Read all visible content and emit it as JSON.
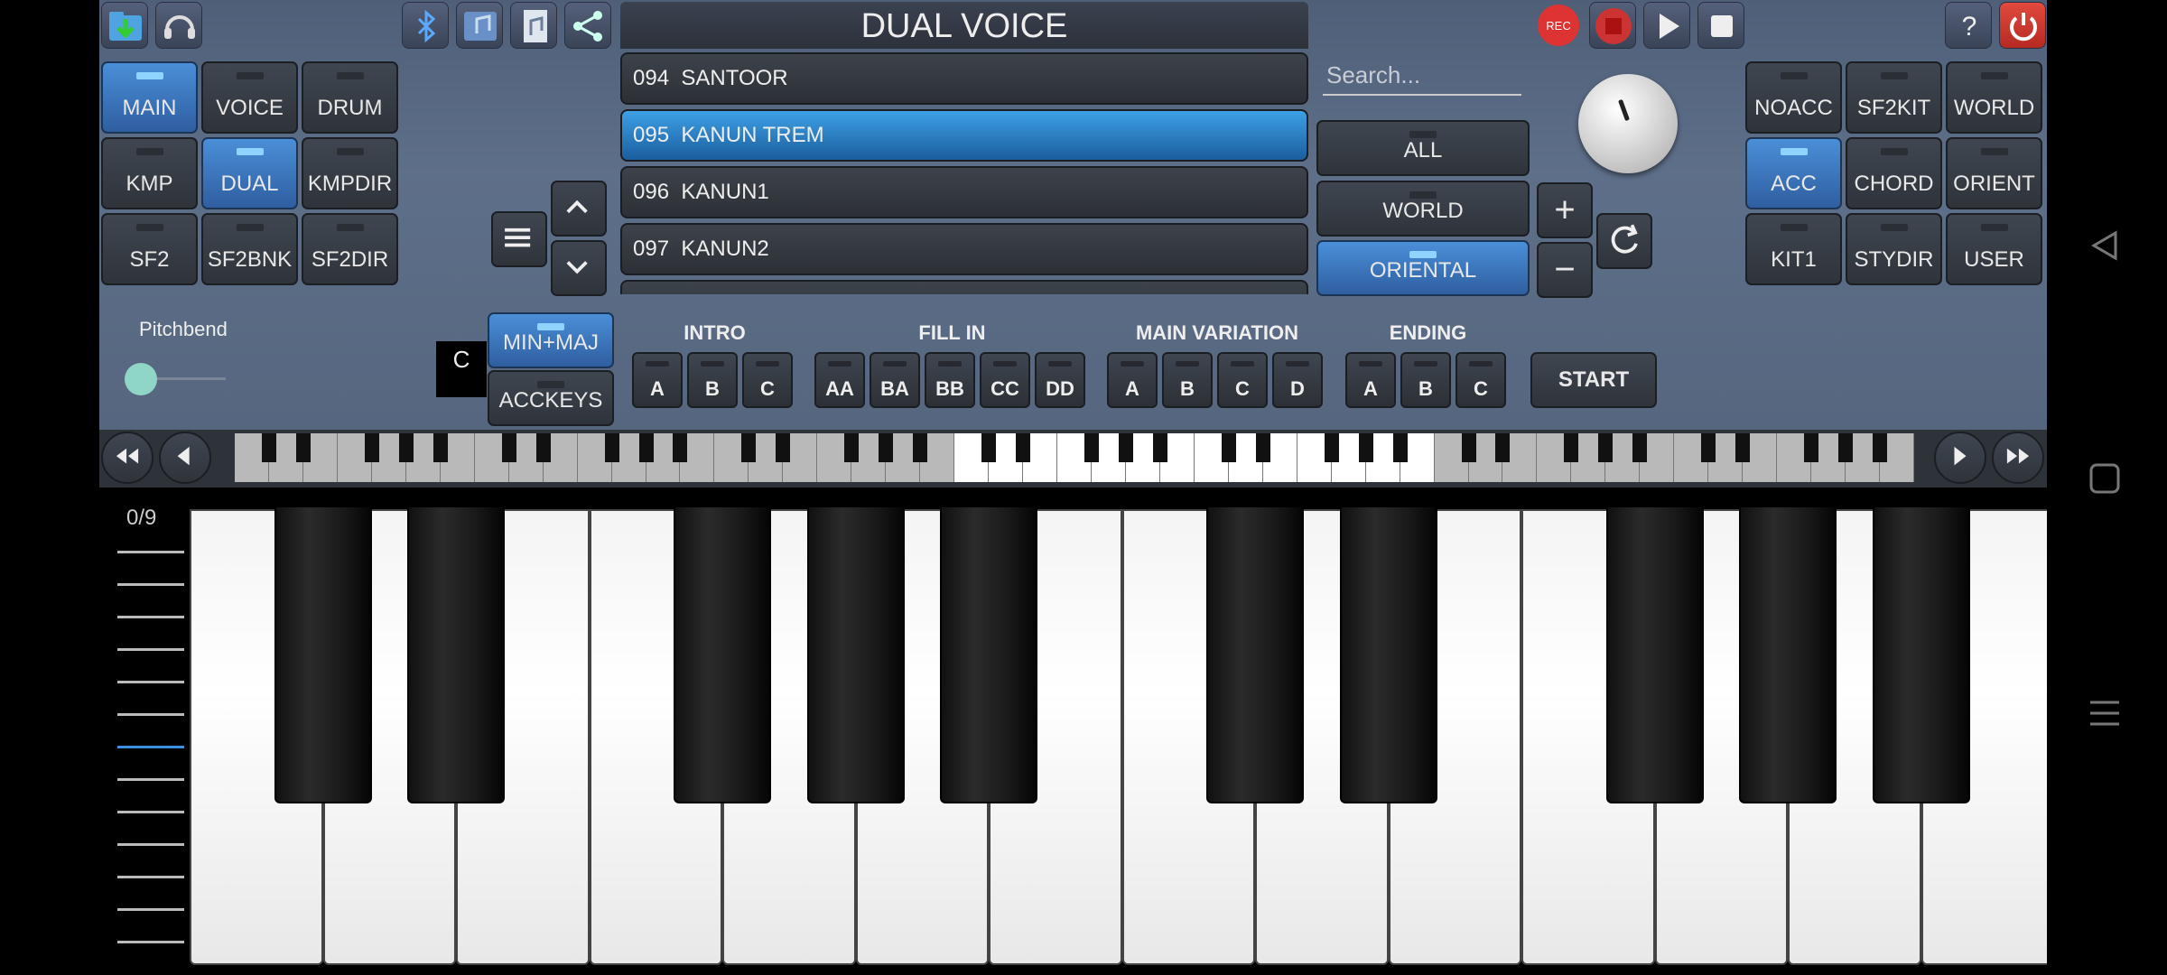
{
  "title": "DUAL VOICE",
  "search": {
    "placeholder": "Search..."
  },
  "mode_buttons": [
    {
      "label": "MAIN",
      "on": true
    },
    {
      "label": "VOICE",
      "on": false
    },
    {
      "label": "DRUM",
      "on": false
    },
    {
      "label": "KMP",
      "on": false
    },
    {
      "label": "DUAL",
      "on": true
    },
    {
      "label": "KMPDIR",
      "on": false
    },
    {
      "label": "SF2",
      "on": false
    },
    {
      "label": "SF2BNK",
      "on": false
    },
    {
      "label": "SF2DIR",
      "on": false
    }
  ],
  "style_buttons": [
    {
      "label": "NOACC",
      "on": false
    },
    {
      "label": "SF2KIT",
      "on": false
    },
    {
      "label": "WORLD",
      "on": false
    },
    {
      "label": "ACC",
      "on": true
    },
    {
      "label": "CHORD",
      "on": false
    },
    {
      "label": "ORIENT",
      "on": false
    },
    {
      "label": "KIT1",
      "on": false
    },
    {
      "label": "STYDIR",
      "on": false
    },
    {
      "label": "USER",
      "on": false
    }
  ],
  "voices": [
    {
      "num": "094",
      "name": "SANTOOR"
    },
    {
      "num": "095",
      "name": "KANUN TREM",
      "selected": true
    },
    {
      "num": "096",
      "name": "KANUN1"
    },
    {
      "num": "097",
      "name": "KANUN2"
    }
  ],
  "filters": [
    {
      "label": "ALL",
      "on": false
    },
    {
      "label": "WORLD",
      "on": false
    },
    {
      "label": "ORIENTAL",
      "on": true
    }
  ],
  "pitchbend_label": "Pitchbend",
  "key_display": "C",
  "chord_mode": {
    "minmaj": "MIN+MAJ",
    "ackeys": "ACCKEYS"
  },
  "sections": {
    "intro": {
      "title": "INTRO",
      "buttons": [
        "A",
        "B",
        "C"
      ]
    },
    "fill": {
      "title": "FILL IN",
      "buttons": [
        "AA",
        "BA",
        "BB",
        "CC",
        "DD"
      ]
    },
    "main": {
      "title": "MAIN VARIATION",
      "buttons": [
        "A",
        "B",
        "C",
        "D"
      ]
    },
    "ending": {
      "title": "ENDING",
      "buttons": [
        "A",
        "B",
        "C"
      ]
    }
  },
  "start_label": "START",
  "octave_counter": "0/9",
  "slider_level": 0.45,
  "icons": {
    "top_left": [
      "folder-download-icon",
      "headset-icon"
    ],
    "top_mid": [
      "bluetooth-icon",
      "music-note-icon",
      "song-file-icon",
      "share-icon"
    ],
    "top_right": [
      "rec-button",
      "stop-record-icon",
      "play-icon",
      "stop-icon",
      "help-icon",
      "power-icon"
    ]
  },
  "colors": {
    "accent": "#2f6fc0",
    "selected": "#1f77c6",
    "panel": "#5a6a84"
  }
}
